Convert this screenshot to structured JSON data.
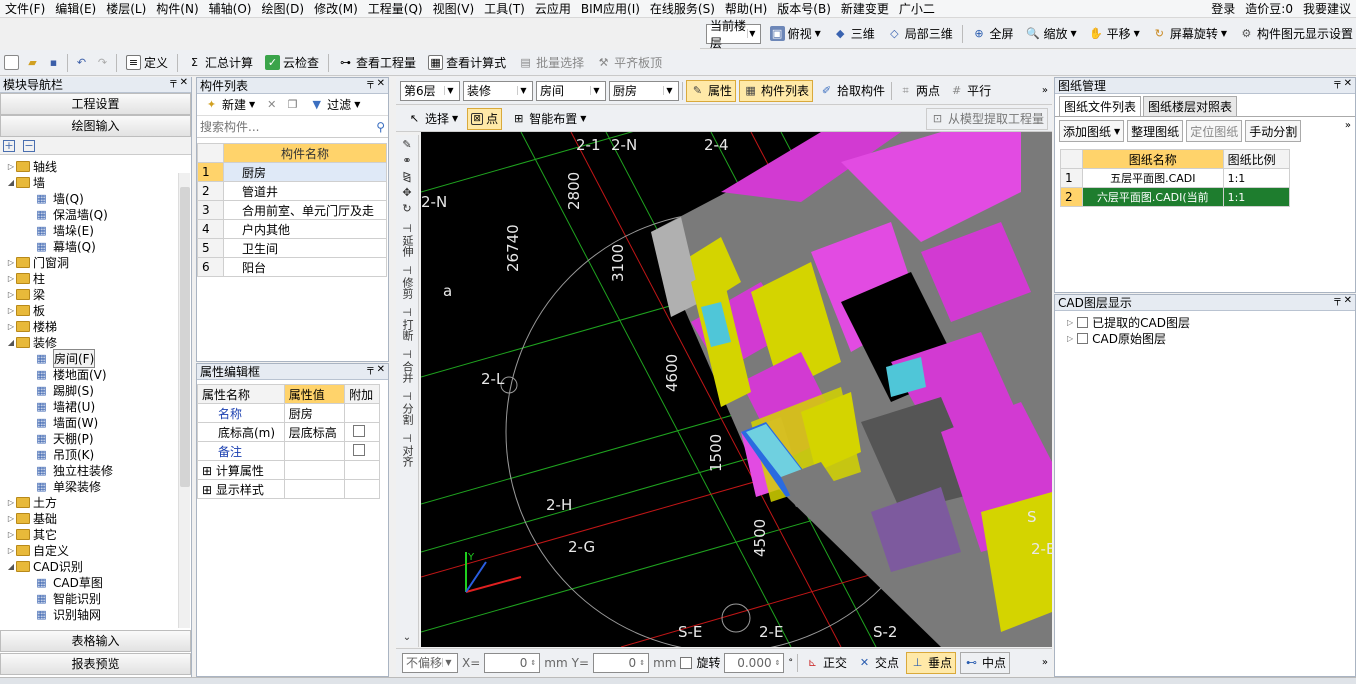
{
  "menu": [
    "文件(F)",
    "编辑(E)",
    "楼层(L)",
    "构件(N)",
    "辅轴(O)",
    "绘图(D)",
    "修改(M)",
    "工程量(Q)",
    "视图(V)",
    "工具(T)",
    "云应用",
    "BIM应用(I)",
    "在线服务(S)",
    "帮助(H)",
    "版本号(B)",
    "新建变更",
    "广小二"
  ],
  "menu_right": [
    "登录",
    "造价豆:0",
    "我要建议"
  ],
  "toolbar_view": {
    "floor_combo": "当前楼层",
    "items": [
      "俯视",
      "三维",
      "局部三维",
      "全屏",
      "缩放",
      "平移",
      "屏幕旋转",
      "构件图元显示设置"
    ]
  },
  "toolbar_main": {
    "items": [
      "定义",
      "汇总计算",
      "云检查",
      "查看工程量",
      "查看计算式",
      "批量选择",
      "平齐板顶"
    ]
  },
  "nav": {
    "title": "模块导航栏",
    "btn_project": "工程设置",
    "btn_draw": "绘图输入",
    "btn_table": "表格输入",
    "btn_report": "报表预览",
    "tree": [
      {
        "label": "轴线",
        "level": 0,
        "open": false
      },
      {
        "label": "墙",
        "level": 0,
        "open": true
      },
      {
        "label": "墙(Q)",
        "level": 1
      },
      {
        "label": "保温墙(Q)",
        "level": 1
      },
      {
        "label": "墙垛(E)",
        "level": 1
      },
      {
        "label": "幕墙(Q)",
        "level": 1
      },
      {
        "label": "门窗洞",
        "level": 0,
        "open": false
      },
      {
        "label": "柱",
        "level": 0,
        "open": false
      },
      {
        "label": "梁",
        "level": 0,
        "open": false
      },
      {
        "label": "板",
        "level": 0,
        "open": false
      },
      {
        "label": "楼梯",
        "level": 0,
        "open": false
      },
      {
        "label": "装修",
        "level": 0,
        "open": true
      },
      {
        "label": "房间(F)",
        "level": 1,
        "selected": true
      },
      {
        "label": "楼地面(V)",
        "level": 1
      },
      {
        "label": "踢脚(S)",
        "level": 1
      },
      {
        "label": "墙裙(U)",
        "level": 1
      },
      {
        "label": "墙面(W)",
        "level": 1
      },
      {
        "label": "天棚(P)",
        "level": 1
      },
      {
        "label": "吊顶(K)",
        "level": 1
      },
      {
        "label": "独立柱装修",
        "level": 1
      },
      {
        "label": "单梁装修",
        "level": 1
      },
      {
        "label": "土方",
        "level": 0,
        "open": false
      },
      {
        "label": "基础",
        "level": 0,
        "open": false
      },
      {
        "label": "其它",
        "level": 0,
        "open": false
      },
      {
        "label": "自定义",
        "level": 0,
        "open": false
      },
      {
        "label": "CAD识别",
        "level": 0,
        "open": true
      },
      {
        "label": "CAD草图",
        "level": 1
      },
      {
        "label": "智能识别",
        "level": 1
      },
      {
        "label": "识别轴网",
        "level": 1
      }
    ]
  },
  "components": {
    "title": "构件列表",
    "new_btn": "新建",
    "filter_btn": "过滤",
    "search_placeholder": "搜索构件...",
    "col_name": "构件名称",
    "rows": [
      "厨房",
      "管道井",
      "合用前室、单元门厅及走",
      "户内其他",
      "卫生间",
      "阳台"
    ],
    "selected": 0
  },
  "props": {
    "title": "属性编辑框",
    "headers": [
      "属性名称",
      "属性值",
      "附加"
    ],
    "rows": [
      {
        "name": "名称",
        "value": "厨房",
        "blue": true
      },
      {
        "name": "底标高(m)",
        "value": "层底标高",
        "check": true
      },
      {
        "name": "备注",
        "value": "",
        "blue": true,
        "check": true
      },
      {
        "name": "计算属性",
        "expand": true
      },
      {
        "name": "显示样式",
        "expand": true
      }
    ]
  },
  "drawbar": {
    "floor": "第6层",
    "type": "装修",
    "sub": "房间",
    "item": "厨房",
    "btn_attr": "属性",
    "btn_list": "构件列表",
    "btn_pick": "拾取构件",
    "btn_two": "两点",
    "btn_parallel": "平行",
    "btn_select": "选择",
    "btn_point": "点",
    "btn_smart": "智能布置",
    "btn_extract": "从模型提取工程量"
  },
  "vtools": [
    "延伸",
    "修剪",
    "打断",
    "合并",
    "分割",
    "对齐"
  ],
  "axes": {
    "labels": [
      "2-1",
      "2-N",
      "2-4",
      "2-N",
      "a",
      "2-L",
      "2-H",
      "2-G",
      "S-E",
      "2-E",
      "S-2",
      "S",
      "2-E"
    ],
    "dims": [
      "2800",
      "26740",
      "3100",
      "4600",
      "1500",
      "4500"
    ]
  },
  "drawing_mgr": {
    "title": "图纸管理",
    "tab1": "图纸文件列表",
    "tab2": "图纸楼层对照表",
    "btns": [
      "添加图纸",
      "整理图纸",
      "定位图纸",
      "手动分割"
    ],
    "cols": [
      "图纸名称",
      "图纸比例"
    ],
    "rows": [
      {
        "name": "五层平面图.CADI",
        "scale": "1:1"
      },
      {
        "name": "六层平面图.CADI(当前",
        "scale": "1:1",
        "selected": true
      }
    ]
  },
  "cad_layers": {
    "title": "CAD图层显示",
    "items": [
      "已提取的CAD图层",
      "CAD原始图层"
    ]
  },
  "status": {
    "offset": "不偏移",
    "x_label": "X=",
    "x_val": "0",
    "y_label": "Y=",
    "y_val": "0",
    "unit": "mm",
    "rotate_label": "旋转",
    "rotate_val": "0.000",
    "ortho": "正交",
    "intersect": "交点",
    "perp": "垂点",
    "mid": "中点"
  },
  "colors": {
    "accent": "#ffd36b",
    "selected_row": "#1e7d2e",
    "wall_yellow": "#d4d400",
    "room_magenta": "#d23ad2",
    "wall_gray": "#9a9a9a"
  }
}
